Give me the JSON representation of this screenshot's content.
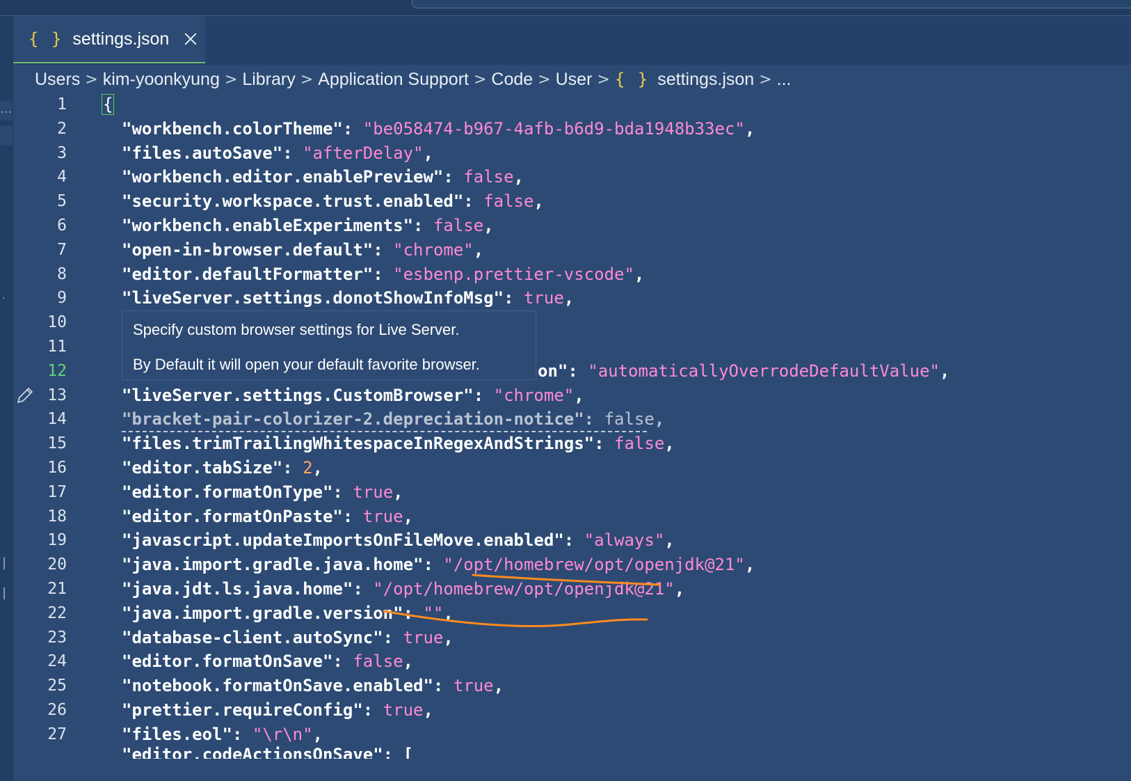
{
  "tab": {
    "icon": "json-braces-icon",
    "braces": "{ }",
    "label": "settings.json"
  },
  "breadcrumb": {
    "segments": [
      "Users",
      "kim-yoonkyung",
      "Library",
      "Application Support",
      "Code",
      "User"
    ],
    "file_braces": "{ }",
    "file": "settings.json",
    "tail": "...",
    "separator": ">"
  },
  "hover": {
    "line1": "Specify custom browser settings for Live Server.",
    "line2": "By Default it will open your default favorite browser."
  },
  "editor": {
    "active_line": 12,
    "open_brace": "{",
    "line12_tail_key": "on\": ",
    "line12_tail_val": "\"automaticallyOverrodeDefaultValue\"",
    "lines": [
      {
        "n": "1"
      },
      {
        "n": "2",
        "key": "\"workbench.colorTheme\": ",
        "val": "\"be058474-b967-4afb-b6d9-bda1948b33ec\"",
        "kind": "s"
      },
      {
        "n": "3",
        "key": "\"files.autoSave\": ",
        "val": "\"afterDelay\"",
        "kind": "s"
      },
      {
        "n": "4",
        "key": "\"workbench.editor.enablePreview\": ",
        "val": "false",
        "kind": "b"
      },
      {
        "n": "5",
        "key": "\"security.workspace.trust.enabled\": ",
        "val": "false",
        "kind": "b"
      },
      {
        "n": "6",
        "key": "\"workbench.enableExperiments\": ",
        "val": "false",
        "kind": "b"
      },
      {
        "n": "7",
        "key": "\"open-in-browser.default\": ",
        "val": "\"chrome\"",
        "kind": "s"
      },
      {
        "n": "8",
        "key": "\"editor.defaultFormatter\": ",
        "val": "\"esbenp.prettier-vscode\"",
        "kind": "s"
      },
      {
        "n": "9",
        "key": "\"liveServer.settings.donotShowInfoMsg\": ",
        "val": "true",
        "kind": "b"
      },
      {
        "n": "10"
      },
      {
        "n": "11"
      },
      {
        "n": "12"
      },
      {
        "n": "13",
        "key": "\"liveServer.settings.CustomBrowser\": ",
        "val": "\"chrome\"",
        "kind": "s"
      },
      {
        "n": "14",
        "key": "\"bracket-pair-colorizer-2.depreciation-notice\": ",
        "val": "false",
        "kind": "b",
        "deprecated": true
      },
      {
        "n": "15",
        "key": "\"files.trimTrailingWhitespaceInRegexAndStrings\": ",
        "val": "false",
        "kind": "b"
      },
      {
        "n": "16",
        "key": "\"editor.tabSize\": ",
        "val": "2",
        "kind": "n"
      },
      {
        "n": "17",
        "key": "\"editor.formatOnType\": ",
        "val": "true",
        "kind": "b"
      },
      {
        "n": "18",
        "key": "\"editor.formatOnPaste\": ",
        "val": "true",
        "kind": "b"
      },
      {
        "n": "19",
        "key": "\"javascript.updateImportsOnFileMove.enabled\": ",
        "val": "\"always\"",
        "kind": "s"
      },
      {
        "n": "20",
        "key": "\"java.import.gradle.java.home\": ",
        "val": "\"/opt/homebrew/opt/openjdk@21\"",
        "kind": "s"
      },
      {
        "n": "21",
        "key": "\"java.jdt.ls.java.home\": ",
        "val": "\"/opt/homebrew/opt/openjdk@21\"",
        "kind": "s"
      },
      {
        "n": "22",
        "key": "\"java.import.gradle.version\": ",
        "val": "\"\"",
        "kind": "s"
      },
      {
        "n": "23",
        "key": "\"database-client.autoSync\": ",
        "val": "true",
        "kind": "b"
      },
      {
        "n": "24",
        "key": "\"editor.formatOnSave\": ",
        "val": "false",
        "kind": "b"
      },
      {
        "n": "25",
        "key": "\"notebook.formatOnSave.enabled\": ",
        "val": "true",
        "kind": "b"
      },
      {
        "n": "26",
        "key": "\"prettier.requireConfig\": ",
        "val": "true",
        "kind": "b"
      },
      {
        "n": "27",
        "key": "\"files.eol\": ",
        "val": "\"\\r\\n\"",
        "kind": "s"
      }
    ],
    "partial_line": "\"editor.codeActionsOnSave\": ["
  },
  "colors": {
    "background": "#2c4a73",
    "string": "#ff8ad3",
    "number": "#ffa66b",
    "active_line_number": "#64d37a",
    "json_icon": "#ecc94b",
    "annotation": "#ff8a1f"
  }
}
